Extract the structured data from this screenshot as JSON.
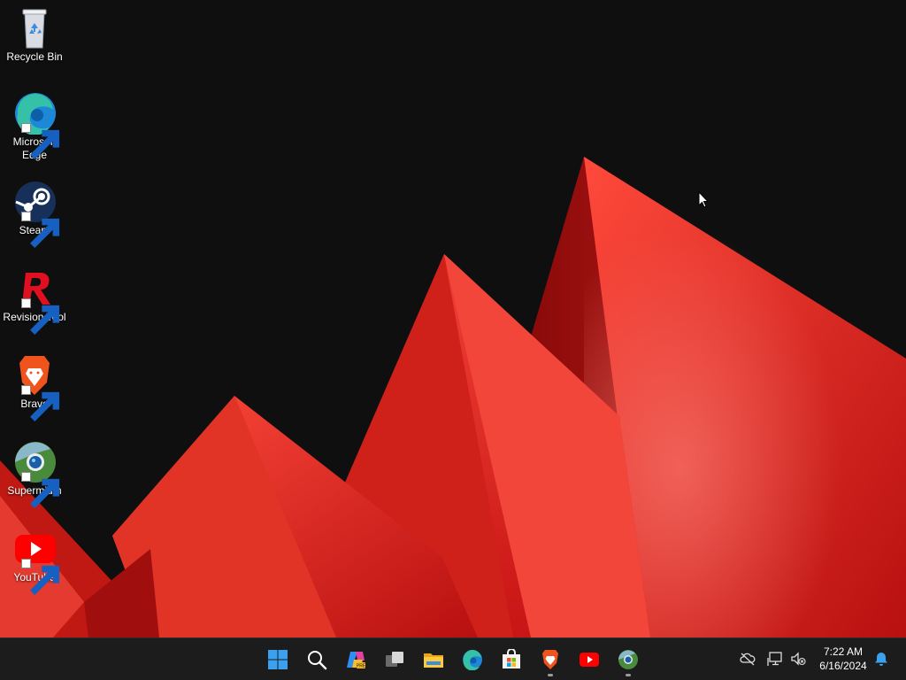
{
  "desktop": {
    "icons": [
      {
        "label": "Recycle Bin",
        "icon": "recycle-bin-icon",
        "shortcut": false
      },
      {
        "label": "Microsoft\nEdge",
        "icon": "edge-icon",
        "shortcut": true
      },
      {
        "label": "Steam",
        "icon": "steam-icon",
        "shortcut": true
      },
      {
        "label": "Revision Tool",
        "icon": "revision-tool-icon",
        "shortcut": true
      },
      {
        "label": "Brave",
        "icon": "brave-icon",
        "shortcut": true
      },
      {
        "label": "Supermium",
        "icon": "supermium-icon",
        "shortcut": true
      },
      {
        "label": "YouTube",
        "icon": "youtube-icon",
        "shortcut": true
      }
    ]
  },
  "taskbar": {
    "pinned": [
      {
        "name": "start",
        "icon": "windows-logo-icon",
        "running": false
      },
      {
        "name": "search",
        "icon": "search-icon",
        "running": false
      },
      {
        "name": "copilot",
        "icon": "copilot-icon",
        "running": false
      },
      {
        "name": "task-view",
        "icon": "task-view-icon",
        "running": false
      },
      {
        "name": "file-explorer",
        "icon": "folder-icon",
        "running": false
      },
      {
        "name": "edge",
        "icon": "edge-icon",
        "running": false
      },
      {
        "name": "store",
        "icon": "store-icon",
        "running": false
      },
      {
        "name": "brave",
        "icon": "brave-icon",
        "running": true
      },
      {
        "name": "youtube",
        "icon": "youtube-icon",
        "running": false
      },
      {
        "name": "supermium",
        "icon": "supermium-icon",
        "running": true
      }
    ],
    "tray": {
      "icons": [
        "cloud-offline-icon",
        "network-icon",
        "volume-muted-icon"
      ],
      "time": "7:22 AM",
      "date": "6/16/2024",
      "notification_icon": "bell-icon"
    }
  },
  "colors": {
    "taskbar_bg": "#1c1c1c",
    "desktop_bg": "#0f0f0f",
    "wallpaper_accent": "#e8302a"
  }
}
